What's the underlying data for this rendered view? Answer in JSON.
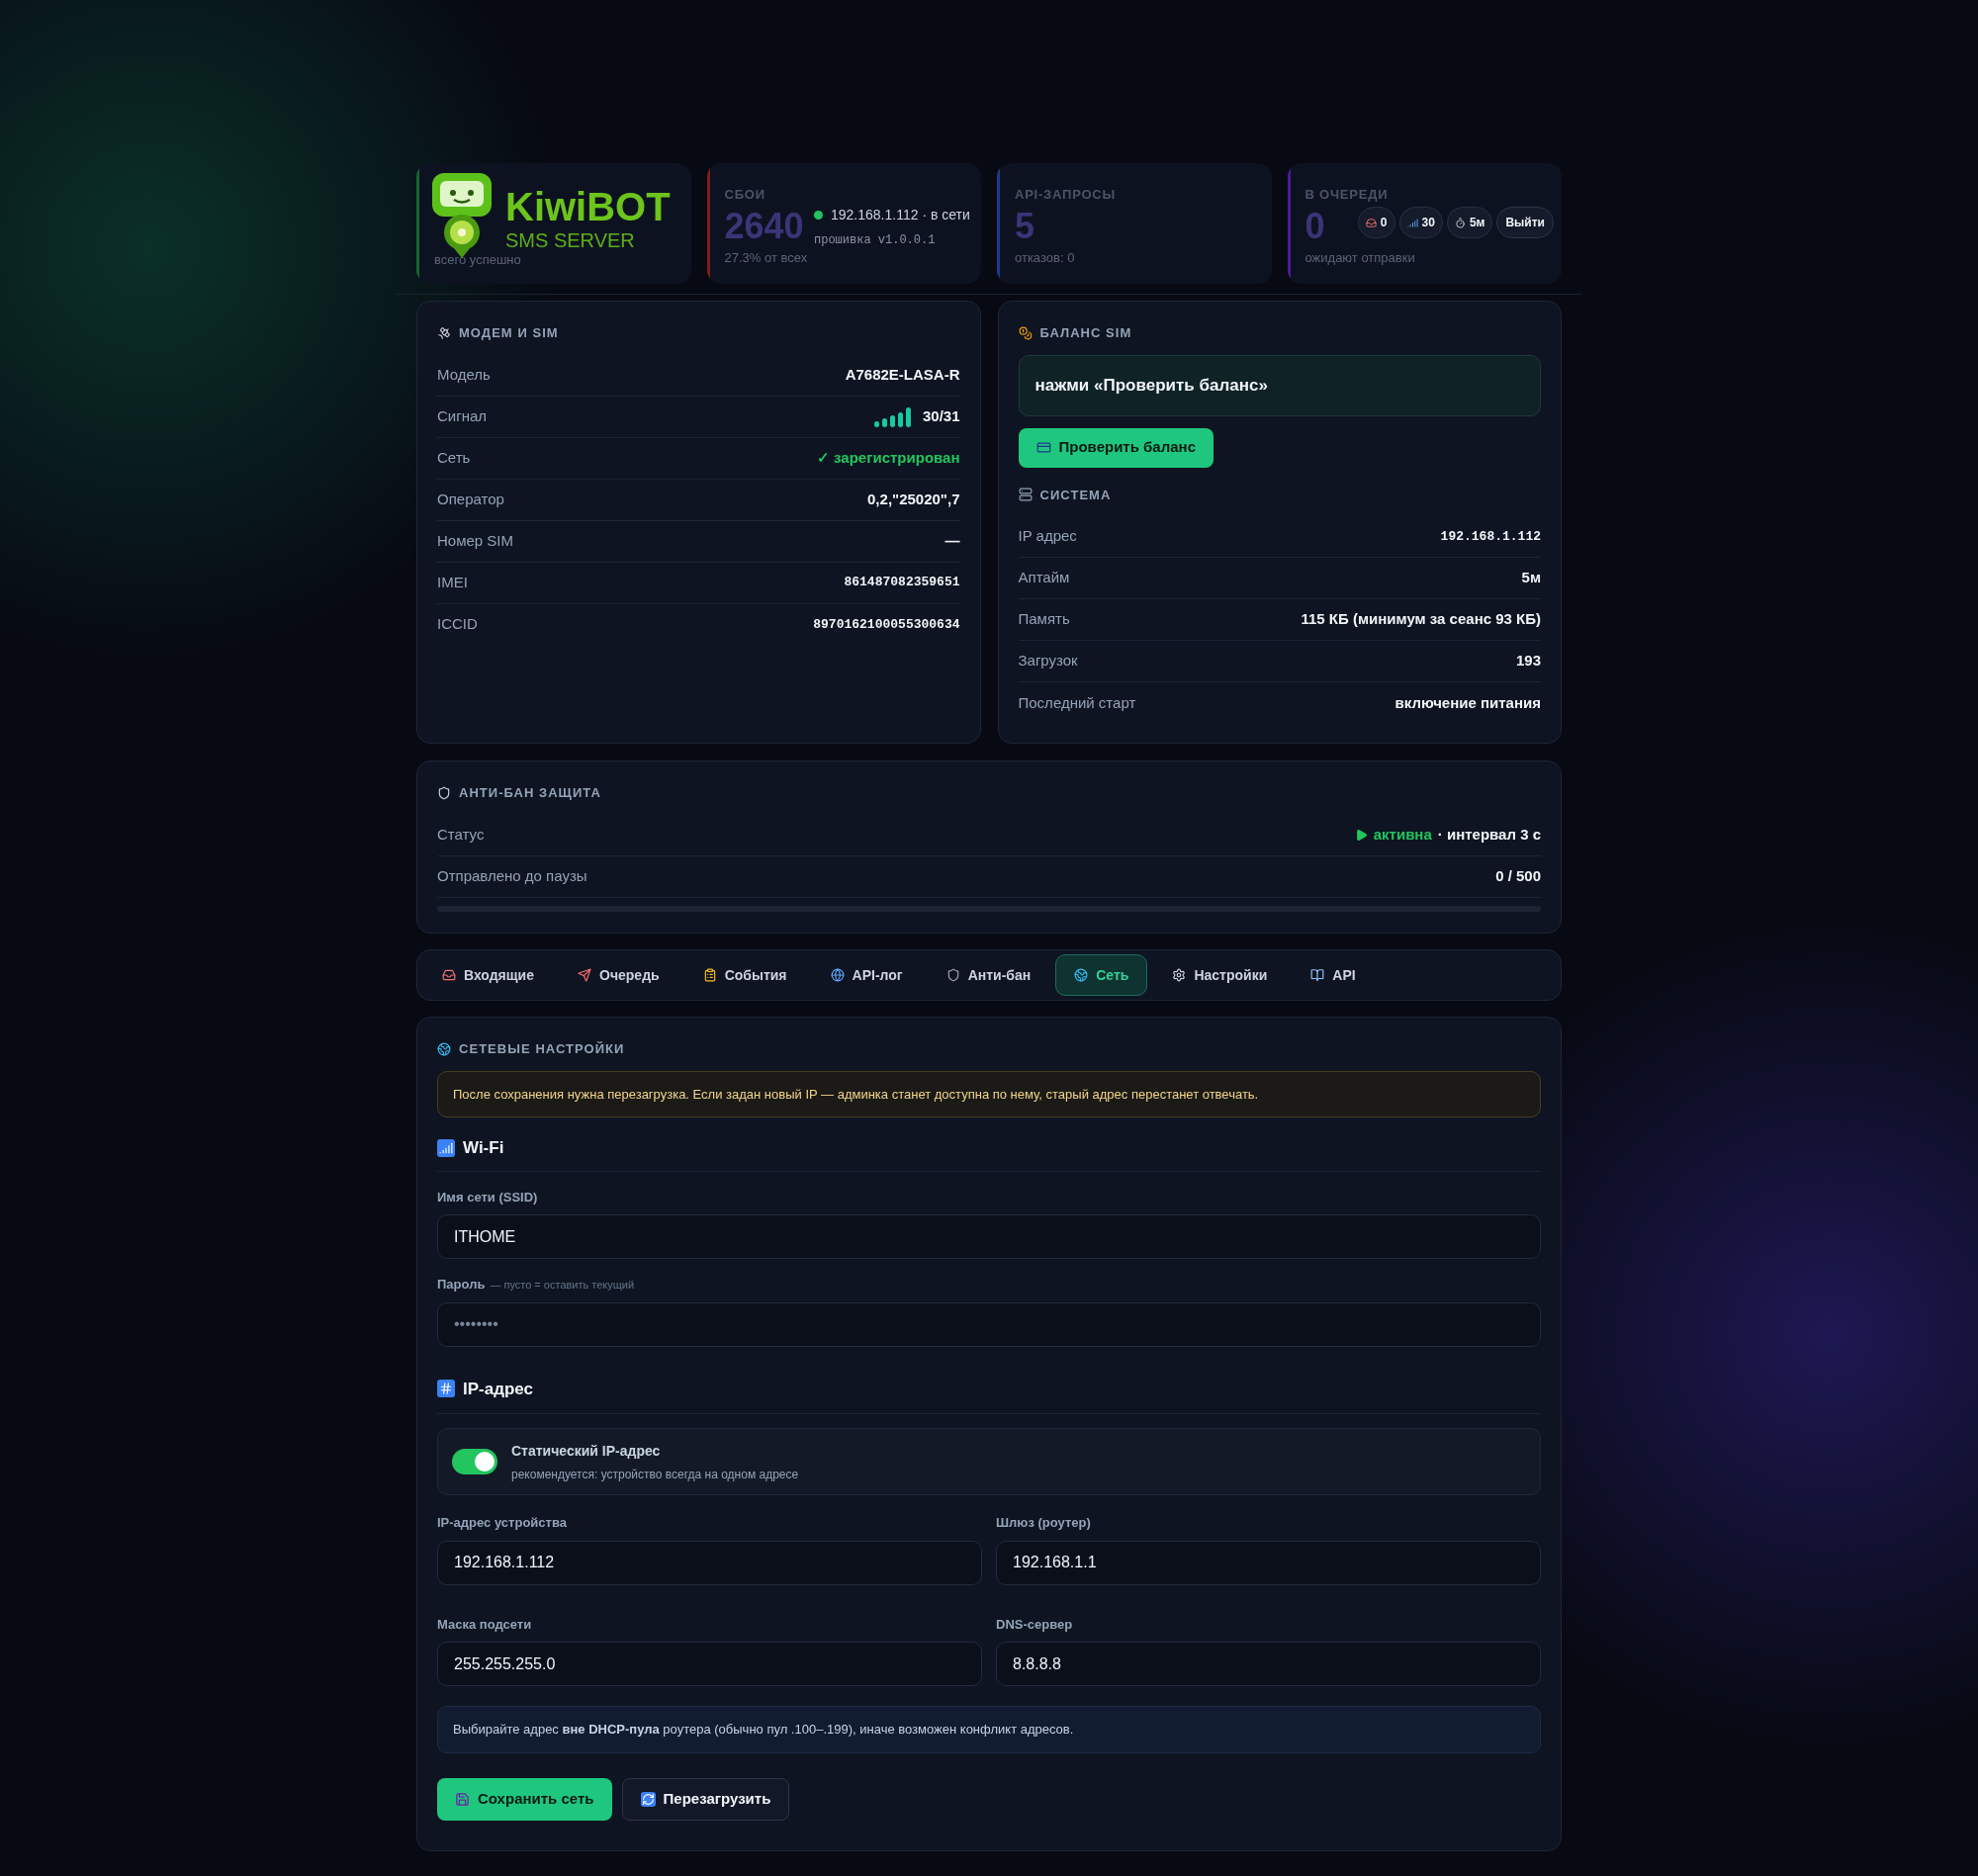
{
  "header": {
    "logo": {
      "title": "KiwiBOT",
      "subtitle": "SMS SERVER"
    },
    "device": {
      "online": true,
      "status": "192.168.1.112 · в сети",
      "firmware": "прошивка v1.0.0.1"
    },
    "badges": [
      {
        "kind": "inbox",
        "text": "0"
      },
      {
        "kind": "signal",
        "text": "30"
      },
      {
        "kind": "timer",
        "text": "5м"
      }
    ],
    "logout": "Выйти"
  },
  "stats": [
    {
      "color": "#166534",
      "caption": "всего успешно"
    },
    {
      "color": "#7f1d1d",
      "label": "СБОИ",
      "value": "2640",
      "caption": "27.3% от всех"
    },
    {
      "color": "#1e3a8a",
      "label": "API-ЗАПРОСЫ",
      "value": "5",
      "caption": "отказов: 0"
    },
    {
      "color": "#4c1d95",
      "label": "В ОЧЕРЕДИ",
      "value": "0",
      "caption": "ожидают отправки"
    }
  ],
  "modem": {
    "title": "МОДЕМ И SIM",
    "rows": [
      {
        "kind": "text",
        "label": "Модель",
        "value": "A7682E-LASA-R"
      },
      {
        "kind": "signal",
        "label": "Сигнал",
        "value": "30/31"
      },
      {
        "kind": "ok",
        "label": "Сеть",
        "value": "✓ зарегистрирован"
      },
      {
        "kind": "text",
        "label": "Оператор",
        "value": "0,2,\"25020\",7"
      },
      {
        "kind": "text",
        "label": "Номер SIM",
        "value": "—"
      },
      {
        "kind": "mono",
        "label": "IMEI",
        "value": "861487082359651"
      },
      {
        "kind": "mono",
        "label": "ICCID",
        "value": "8970162100055300634"
      }
    ]
  },
  "balance": {
    "title": "БАЛАНС SIM",
    "message": "нажми «Проверить баланс»",
    "button": "Проверить баланс"
  },
  "system": {
    "title": "СИСТЕМА",
    "rows": [
      {
        "kind": "mono",
        "label": "IP адрес",
        "value": "192.168.1.112"
      },
      {
        "kind": "text",
        "label": "Аптайм",
        "value": "5м"
      },
      {
        "kind": "text",
        "label": "Память",
        "value": "115 КБ (минимум за сеанс 93 КБ)"
      },
      {
        "kind": "text",
        "label": "Загрузок",
        "value": "193"
      },
      {
        "kind": "text",
        "label": "Последний старт",
        "value": "включение питания"
      }
    ]
  },
  "antiban": {
    "title": "АНТИ-БАН ЗАЩИТА",
    "status": {
      "label": "Статус",
      "active": true,
      "state": "активна",
      "detail": "· интервал 3 с"
    },
    "sent": {
      "label": "Отправлено до паузы",
      "value": "0 / 500",
      "level": 0
    }
  },
  "tabs": [
    {
      "kind": "inbox",
      "label": "Входящие",
      "selected": false
    },
    {
      "kind": "outbox",
      "label": "Очередь",
      "selected": false
    },
    {
      "kind": "events",
      "label": "События",
      "selected": false
    },
    {
      "kind": "apilog",
      "label": "API-лог",
      "selected": false
    },
    {
      "kind": "antiban",
      "label": "Анти-бан",
      "selected": false
    },
    {
      "kind": "network",
      "label": "Сеть",
      "selected": true
    },
    {
      "kind": "settings",
      "label": "Настройки",
      "selected": false
    },
    {
      "kind": "api",
      "label": "API",
      "selected": false
    }
  ],
  "network": {
    "title": "СЕТЕВЫЕ НАСТРОЙКИ",
    "warning": "После сохранения нужна перезагрузка. Если задан новый IP — админка станет доступна по нему, старый адрес перестанет отвечать.",
    "wifi": {
      "heading": "Wi-Fi",
      "ssid": {
        "label": "Имя сети (SSID)",
        "value": "ITHOME"
      },
      "password": {
        "label": "Пароль",
        "hint": "— пусто = оставить текущий",
        "placeholder": "••••••••"
      }
    },
    "ip": {
      "heading": "IP-адрес",
      "static": {
        "title": "Статический IP-адрес",
        "subtitle": "рекомендуется: устройство всегда на одном адресе",
        "on": true
      },
      "fields": [
        {
          "label": "IP-адрес устройства",
          "value": "192.168.1.112"
        },
        {
          "label": "Шлюз (роутер)",
          "value": "192.168.1.1"
        },
        {
          "label": "Маска подсети",
          "value": "255.255.255.0"
        },
        {
          "label": "DNS-сервер",
          "value": "8.8.8.8"
        }
      ],
      "note": "Выбирайте адрес **вне DHCP-пула** роутера (обычно пул .100–.199), иначе возможен конфликт адресов."
    },
    "save": "Сохранить сеть",
    "reboot": "Перезагрузить"
  }
}
